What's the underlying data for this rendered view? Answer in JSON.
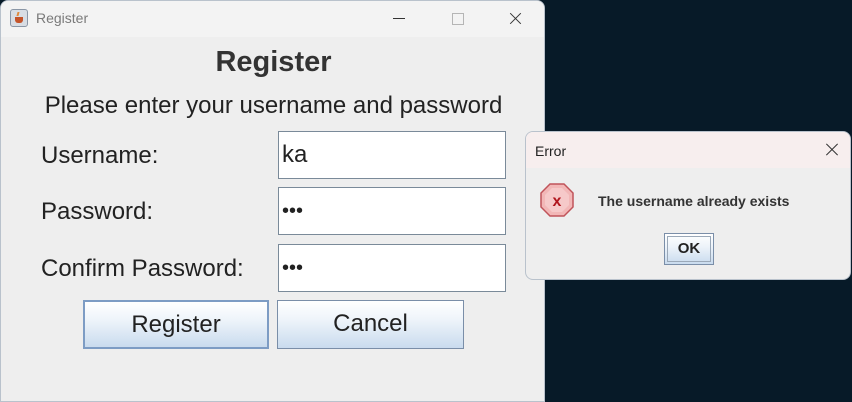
{
  "main_window": {
    "title": "Register",
    "heading": "Register",
    "subtitle": "Please enter your username and password",
    "labels": {
      "username": "Username:",
      "password": "Password:",
      "confirm_password": "Confirm Password:"
    },
    "fields": {
      "username_value": "ka",
      "password_value": "•••",
      "confirm_password_value": "•••"
    },
    "buttons": {
      "register": "Register",
      "cancel": "Cancel"
    }
  },
  "error_dialog": {
    "title": "Error",
    "message": "The username already exists",
    "ok_label": "OK",
    "icon": "error-icon"
  },
  "colors": {
    "desktop": "#071a28",
    "window_bg": "#eeeeee",
    "error_icon": "#e0353a"
  }
}
